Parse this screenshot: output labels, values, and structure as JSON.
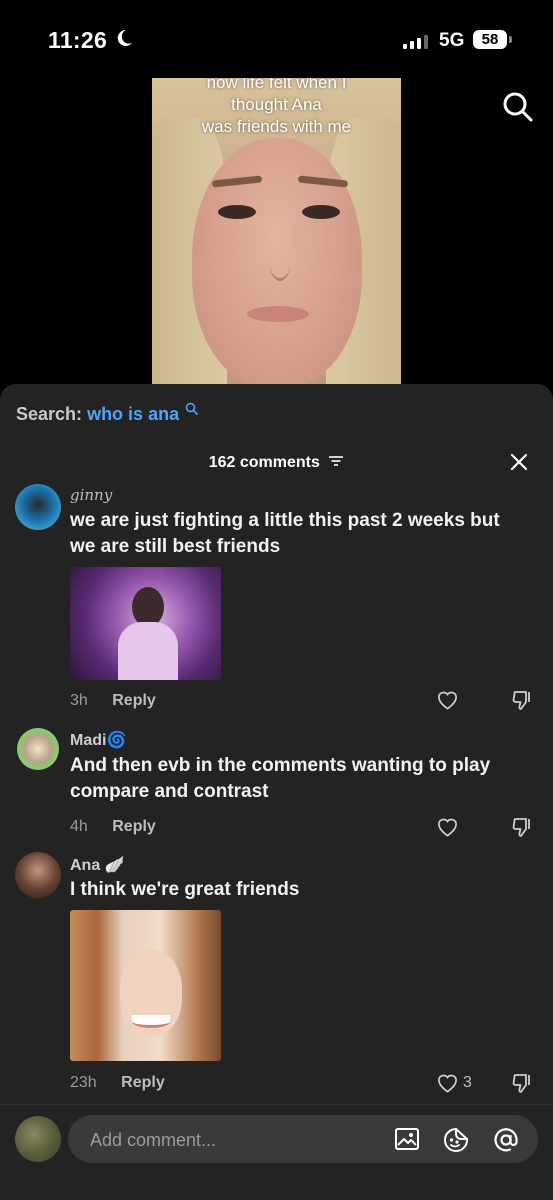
{
  "status_bar": {
    "time": "11:26",
    "network": "5G",
    "battery": "58"
  },
  "video": {
    "caption_cut": "now life felt when I",
    "caption_lines": [
      "thought Ana",
      "was friends with me"
    ]
  },
  "sheet": {
    "search_label": "Search:",
    "search_term": "who is ana",
    "comments_count": "162 comments"
  },
  "comments": [
    {
      "username": "ginny",
      "text": "we are just fighting a little this past 2 weeks but we are still best friends",
      "time": "3h",
      "reply": "Reply",
      "likes": ""
    },
    {
      "username": "Madi",
      "emoji": "🌀",
      "text": "And then evb in the comments wanting to play compare and contrast",
      "time": "4h",
      "reply": "Reply",
      "likes": ""
    },
    {
      "username": "Ana",
      "emoji": "🪽",
      "text": "I think we're great friends",
      "time": "23h",
      "reply": "Reply",
      "likes": "3"
    }
  ],
  "composer": {
    "placeholder": "Add comment..."
  },
  "colors": {
    "sheet_bg": "#232323",
    "accent_link": "#4ea3ff",
    "input_bg": "#3a3a3a"
  }
}
